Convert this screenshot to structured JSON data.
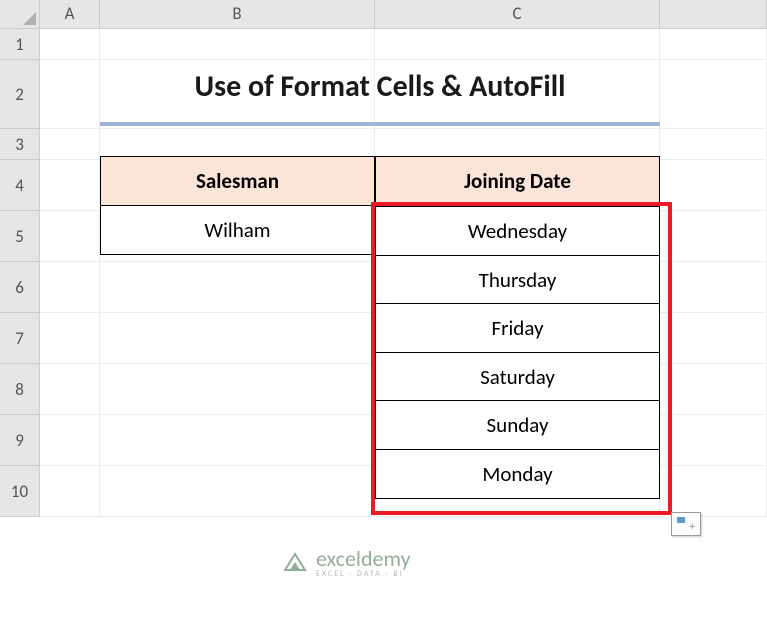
{
  "columns": [
    "A",
    "B",
    "C"
  ],
  "rows": [
    "1",
    "2",
    "3",
    "4",
    "5",
    "6",
    "7",
    "8",
    "9",
    "10"
  ],
  "title": "Use of Format Cells & AutoFill",
  "table": {
    "headers": {
      "salesman": "Salesman",
      "joining_date": "Joining Date"
    },
    "wilham": "Wilham"
  },
  "chart_data": {
    "type": "table",
    "title": "Use of Format Cells & AutoFill",
    "columns": [
      "Salesman",
      "Joining Date"
    ],
    "rows": [
      [
        "Wilham",
        "Wednesday"
      ],
      [
        "",
        "Thursday"
      ],
      [
        "",
        "Friday"
      ],
      [
        "",
        "Saturday"
      ],
      [
        "",
        "Sunday"
      ],
      [
        "",
        "Monday"
      ]
    ]
  },
  "days": [
    "Wednesday",
    "Thursday",
    "Friday",
    "Saturday",
    "Sunday",
    "Monday"
  ],
  "watermark": {
    "main": "exceldemy",
    "sub": "EXCEL · DATA · BI"
  }
}
